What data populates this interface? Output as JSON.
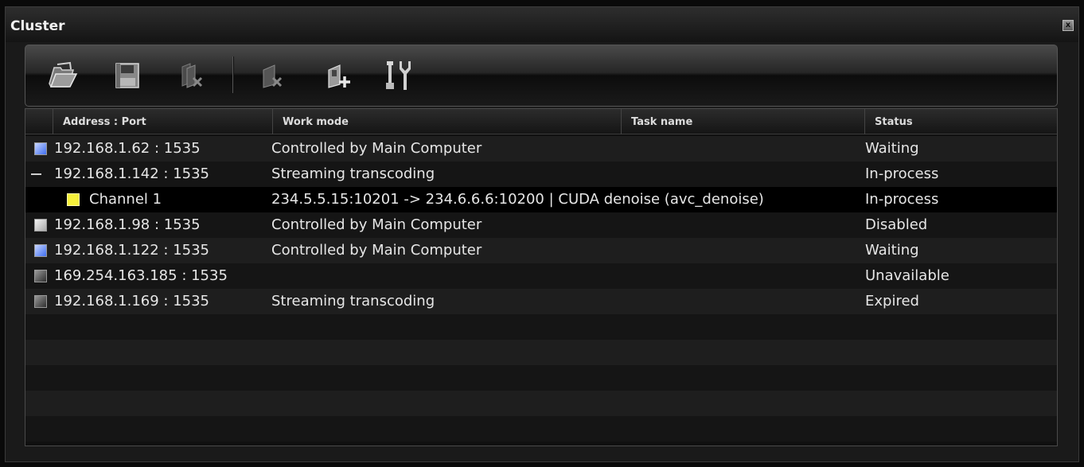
{
  "window": {
    "title": "Cluster",
    "close_label": "x"
  },
  "toolbar": {
    "buttons": [
      {
        "icon": "open-folder-icon"
      },
      {
        "icon": "save-disk-icon"
      },
      {
        "icon": "remove-multiple-icon"
      },
      {
        "icon": "remove-node-icon"
      },
      {
        "icon": "add-node-icon"
      },
      {
        "icon": "settings-tools-icon"
      }
    ]
  },
  "grid": {
    "columns": [
      "Address : Port",
      "Work mode",
      "Task name",
      "Status"
    ],
    "rows": [
      {
        "address": "192.168.1.62 : 1535",
        "mode": "Controlled by Main Computer",
        "task": "",
        "status": "Waiting",
        "indicator": "#4f7df0"
      },
      {
        "address": "192.168.1.142 : 1535",
        "mode": "Streaming transcoding",
        "task": "",
        "status": "In-process",
        "indicator": "collapse"
      },
      {
        "address": "Channel 1",
        "mode": "234.5.5.15:10201 -> 234.6.6.6:10200 | CUDA denoise (avc_denoise)",
        "task": "",
        "status": "In-process",
        "indicator": "#f5f03a"
      },
      {
        "address": "192.168.1.98 : 1535",
        "mode": "Controlled by Main Computer",
        "task": "",
        "status": "Disabled",
        "indicator": "#d8d8d8"
      },
      {
        "address": "192.168.1.122 : 1535",
        "mode": "Controlled by Main Computer",
        "task": "",
        "status": "Waiting",
        "indicator": "#4f7df0"
      },
      {
        "address": "169.254.163.185 : 1535",
        "mode": "",
        "task": "",
        "status": "Unavailable",
        "indicator": "#6a6a6a"
      },
      {
        "address": "192.168.1.169 : 1535",
        "mode": "Streaming transcoding",
        "task": "",
        "status": "Expired",
        "indicator": "#6a6a6a"
      }
    ]
  }
}
